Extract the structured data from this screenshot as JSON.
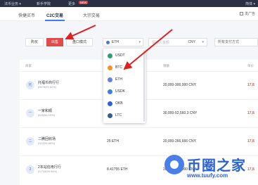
{
  "topbar": {
    "nav1": "法币业务 ▾",
    "nav2": "新手学院",
    "nav3": "更多",
    "badge": "NEW",
    "lang": "简体 ▾"
  },
  "tabs": {
    "t1": "快捷买币",
    "t2": "C2C交易",
    "t3": "大宗交易",
    "ad": "发广告"
  },
  "filters": {
    "buy": "购买",
    "sell": "出售",
    "quick": "盘口模式",
    "coin": "ETH",
    "amount_placeholder": "请输入金额",
    "currency": "CNY",
    "payment": "所有支付方式"
  },
  "table": {
    "headers": [
      "商家",
      "数量",
      "限额",
      "单价"
    ],
    "rows": [
      {
        "avatar": "托",
        "name": "托福币商行行",
        "stats": "(8578|99.62%)",
        "qty": "",
        "limit": "20,000-300,000 CNY",
        "price": "17,8"
      },
      {
        "avatar": "一",
        "name": "一家和顺",
        "stats": "(626|98.16%)",
        "qty": "",
        "limit": "30,000-52,560.3 CNY",
        "price": "17,8"
      },
      {
        "avatar": "二",
        "name": "二腾回收场",
        "stats": "(512|99.88%)",
        "qty": "25 ETH",
        "limit": "20,000-266,666 CNY",
        "price": "17,8"
      },
      {
        "avatar": "2",
        "name": "2本站信用行行",
        "stats": "(5,744|99.94%)",
        "qty": "8.41755 ETH",
        "limit": "20,000-300,000 CNY",
        "price": "17,8"
      }
    ]
  },
  "dropdown": {
    "items": [
      {
        "label": "USDT",
        "color": "#26a17b"
      },
      {
        "label": "BTC",
        "color": "#f7931a"
      },
      {
        "label": "ETH",
        "color": "#627eea"
      },
      {
        "label": "USDK",
        "color": "#3b82d6"
      },
      {
        "label": "OKB",
        "color": "#2a64d9"
      },
      {
        "label": "LTC",
        "color": "#345d9d"
      }
    ]
  },
  "watermark": {
    "cn": "币圈之家",
    "url": "www.tuufy.com"
  },
  "accent": "#e04c4c",
  "arrow_color": "#e02020"
}
